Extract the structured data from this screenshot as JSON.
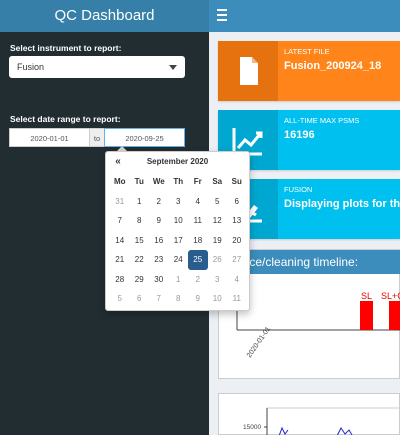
{
  "app": {
    "title": "QC Dashboard"
  },
  "sidebar": {
    "instrument_label": "Select instrument to report:",
    "instrument_value": "Fusion",
    "date_label": "Select date range to report:",
    "date_start": "2020-01-01",
    "date_sep": "to",
    "date_end": "2020-09-25"
  },
  "calendar": {
    "prev": "«",
    "title": "September 2020",
    "weekdays": [
      "Mo",
      "Tu",
      "We",
      "Th",
      "Fr",
      "Sa",
      "Su"
    ],
    "days": [
      [
        "31",
        "1",
        "2",
        "3",
        "4",
        "5",
        "6"
      ],
      [
        "7",
        "8",
        "9",
        "10",
        "11",
        "12",
        "13"
      ],
      [
        "14",
        "15",
        "16",
        "17",
        "18",
        "19",
        "20"
      ],
      [
        "21",
        "22",
        "23",
        "24",
        "25",
        "26",
        "27"
      ],
      [
        "28",
        "29",
        "30",
        "1",
        "2",
        "3",
        "4"
      ],
      [
        "5",
        "6",
        "7",
        "8",
        "9",
        "10",
        "11"
      ]
    ],
    "selected": "25"
  },
  "infoboxes": [
    {
      "label": "LATEST FILE",
      "value": "Fusion_200924_18",
      "color": "#ff851b",
      "icon_bg": "#e5720f"
    },
    {
      "label": "ALL-TIME MAX PSMS",
      "value": "16196",
      "color": "#00c0ef",
      "icon_bg": "#00a7d0"
    },
    {
      "label": "FUSION",
      "value": "Displaying plots for the",
      "color": "#00c0ef",
      "icon_bg": "#00a7d0"
    }
  ],
  "timeline": {
    "title": "Service/cleaning timeline:",
    "date_label": "2020-01-01",
    "markers": [
      "SL",
      "SL+C"
    ]
  },
  "chart2": {
    "ytick": "15000"
  }
}
